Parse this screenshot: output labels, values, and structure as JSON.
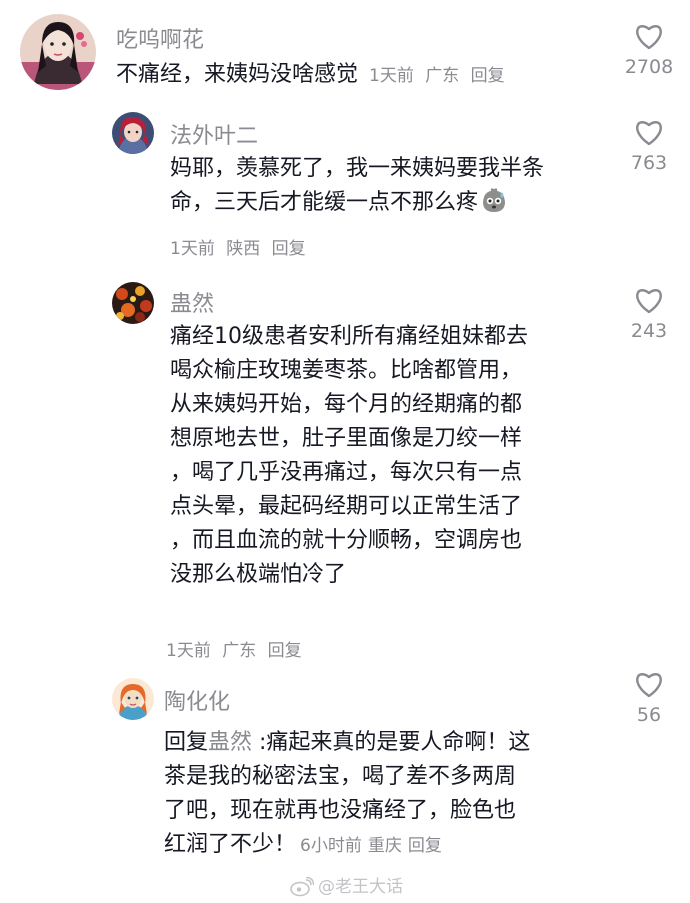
{
  "comments": [
    {
      "username": "吃呜啊花",
      "text": "不痛经，来姨妈没啥感觉",
      "time": "1天前",
      "location": "广东",
      "reply": "回复",
      "likes": "2708"
    },
    {
      "username": "法外叶二",
      "text": "妈耶，羡慕死了，我一来姨妈要我半条命，三天后才能缓一点不那么疼",
      "emoji": "sweat-face",
      "time": "1天前",
      "location": "陕西",
      "reply": "回复",
      "likes": "763"
    },
    {
      "username": "蛊然",
      "lines": [
        "痛经10级患者安利所有痛经姐妹都去",
        "喝众榆庄玫瑰姜枣茶。比啥都管用，",
        "从来姨妈开始，每个月的经期痛的都",
        "想原地去世，肚子里面像是刀绞一样",
        "，喝了几乎没再痛过，每次只有一点",
        "点头晕，最起码经期可以正常生活了",
        "，而且血流的就十分顺畅，空调房也",
        "没那么极端怕冷了"
      ],
      "time": "1天前",
      "location": "广东",
      "reply": "回复",
      "likes": "243"
    },
    {
      "username": "陶化化",
      "reply_prefix": "回复",
      "mention": "蛊然",
      "lines": [
        " :痛起来真的是要人命啊！这",
        "茶是我的秘密法宝，喝了差不多两周",
        "了吧，现在就再也没痛经了，脸色也",
        "红润了不少！"
      ],
      "time": "6小时前",
      "location": "重庆",
      "reply": "回复",
      "likes": "56"
    }
  ],
  "watermark": "@老王大话",
  "colors": {
    "text": "#161823",
    "secondary": "#8a8b91",
    "watermark": "#c4c4c8"
  }
}
